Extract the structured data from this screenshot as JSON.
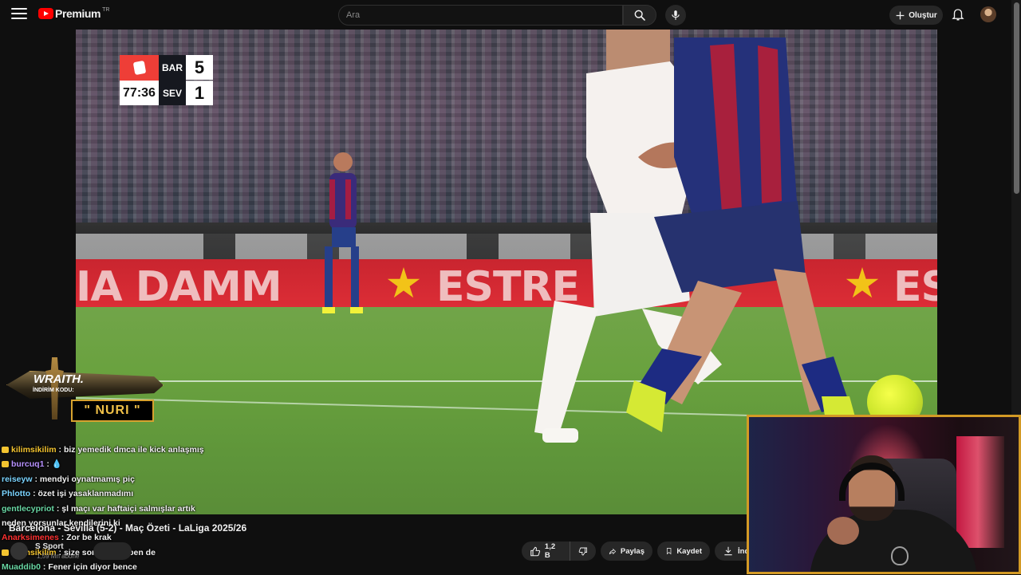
{
  "header": {
    "logo_text": "Premium",
    "region": "TR",
    "search_placeholder": "Ara",
    "create_label": "Oluştur"
  },
  "scoreboard": {
    "home_team": "BAR",
    "away_team": "SEV",
    "home_score": "5",
    "away_score": "1",
    "clock": "77:36"
  },
  "sponsor": {
    "brand": "WRAITH.",
    "code_label": "İNDİRİM KODU:",
    "code": "\" NURI \""
  },
  "chat": [
    {
      "user": "kilimsikilim",
      "text": ": biz yemedik dmca ile kick anlaşmış",
      "color": "#f4c430",
      "badge": true
    },
    {
      "user": "burcuq1",
      "text": ": 💧",
      "color": "#b892ff",
      "badge": true
    },
    {
      "user": "reiseyw",
      "text": ": mendyi oynatmamış piç",
      "color": "#7bd4ff",
      "badge": false
    },
    {
      "user": "Phlotto",
      "text": ": özet işi yasaklanmadımı",
      "color": "#7bd4ff",
      "badge": false
    },
    {
      "user": "gentlecypriot",
      "text": ": şl maçı var haftaiçi salmışlar artık",
      "color": "#69d7a4",
      "badge": false
    },
    {
      "user": "",
      "text": "neden yorsunlar kendilerini ki",
      "color": "#f1f1f1",
      "badge": false
    },
    {
      "user": "Anarksimenes",
      "text": ": Zor be krak",
      "color": "#ff3131",
      "badge": false
    },
    {
      "user": "kilimsikilim",
      "text": ": size soracaktım ben de",
      "color": "#f4c430",
      "badge": true
    },
    {
      "user": "Muaddib0",
      "text": ": Fener için diyor bence",
      "color": "#69d7a4",
      "badge": false
    }
  ],
  "video": {
    "title": "Barcelona - Sevilla (5-2) - Maç Özeti - LaLiga 2025/26",
    "channel": "S Sport",
    "subscribers": "1,59 Mn abone"
  },
  "actions": {
    "likes": "1,2 B",
    "share": "Paylaş",
    "save": "Kaydet",
    "download": "İndir"
  }
}
